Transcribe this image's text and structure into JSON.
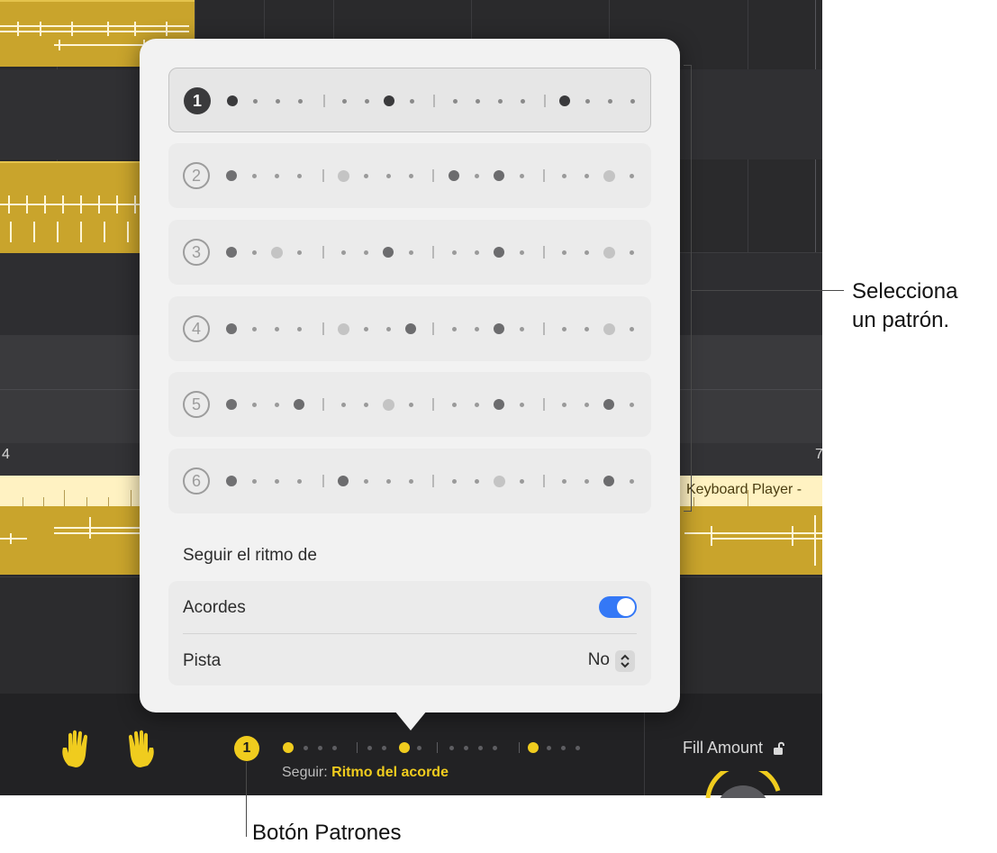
{
  "popover": {
    "patterns": [
      {
        "number": "1",
        "selected": true
      },
      {
        "number": "2",
        "selected": false
      },
      {
        "number": "3",
        "selected": false
      },
      {
        "number": "4",
        "selected": false
      },
      {
        "number": "5",
        "selected": false
      },
      {
        "number": "6",
        "selected": false
      }
    ],
    "follow_section_title": "Seguir el ritmo de",
    "chords_label": "Acordes",
    "chords_enabled": true,
    "track_label": "Pista",
    "track_value": "No"
  },
  "arrange": {
    "ruler_left": "4",
    "ruler_right": "7",
    "region_title": "Keyboard Player -"
  },
  "bottom_bar": {
    "pattern_button": "1",
    "follow_label": "Seguir:",
    "follow_value": "Ritmo del acorde",
    "fill_amount_label": "Fill Amount"
  },
  "callouts": {
    "select_pattern_line1": "Selecciona",
    "select_pattern_line2": "un patrón.",
    "patterns_button": "Botón Patrones"
  },
  "colors": {
    "accent_yellow": "#f0cc1e",
    "region_gold": "#c9a42c",
    "toggle_blue": "#3478f6",
    "popover_bg": "#f2f2f2"
  }
}
